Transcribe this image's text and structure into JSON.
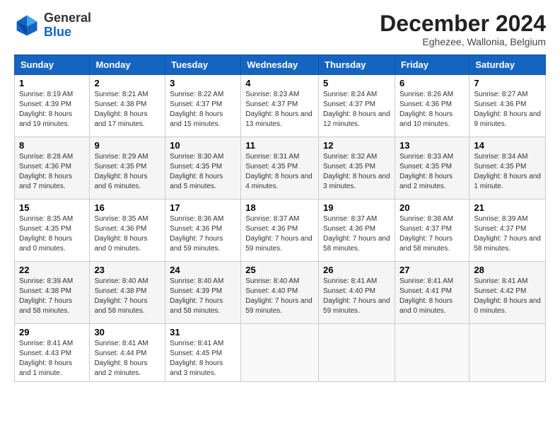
{
  "logo": {
    "line1": "General",
    "line2": "Blue"
  },
  "title": "December 2024",
  "subtitle": "Eghezee, Wallonia, Belgium",
  "days_header": [
    "Sunday",
    "Monday",
    "Tuesday",
    "Wednesday",
    "Thursday",
    "Friday",
    "Saturday"
  ],
  "weeks": [
    [
      {
        "day": "1",
        "sunrise": "8:19 AM",
        "sunset": "4:39 PM",
        "daylight": "8 hours and 19 minutes."
      },
      {
        "day": "2",
        "sunrise": "8:21 AM",
        "sunset": "4:38 PM",
        "daylight": "8 hours and 17 minutes."
      },
      {
        "day": "3",
        "sunrise": "8:22 AM",
        "sunset": "4:37 PM",
        "daylight": "8 hours and 15 minutes."
      },
      {
        "day": "4",
        "sunrise": "8:23 AM",
        "sunset": "4:37 PM",
        "daylight": "8 hours and 13 minutes."
      },
      {
        "day": "5",
        "sunrise": "8:24 AM",
        "sunset": "4:37 PM",
        "daylight": "8 hours and 12 minutes."
      },
      {
        "day": "6",
        "sunrise": "8:26 AM",
        "sunset": "4:36 PM",
        "daylight": "8 hours and 10 minutes."
      },
      {
        "day": "7",
        "sunrise": "8:27 AM",
        "sunset": "4:36 PM",
        "daylight": "8 hours and 9 minutes."
      }
    ],
    [
      {
        "day": "8",
        "sunrise": "8:28 AM",
        "sunset": "4:36 PM",
        "daylight": "8 hours and 7 minutes."
      },
      {
        "day": "9",
        "sunrise": "8:29 AM",
        "sunset": "4:35 PM",
        "daylight": "8 hours and 6 minutes."
      },
      {
        "day": "10",
        "sunrise": "8:30 AM",
        "sunset": "4:35 PM",
        "daylight": "8 hours and 5 minutes."
      },
      {
        "day": "11",
        "sunrise": "8:31 AM",
        "sunset": "4:35 PM",
        "daylight": "8 hours and 4 minutes."
      },
      {
        "day": "12",
        "sunrise": "8:32 AM",
        "sunset": "4:35 PM",
        "daylight": "8 hours and 3 minutes."
      },
      {
        "day": "13",
        "sunrise": "8:33 AM",
        "sunset": "4:35 PM",
        "daylight": "8 hours and 2 minutes."
      },
      {
        "day": "14",
        "sunrise": "8:34 AM",
        "sunset": "4:35 PM",
        "daylight": "8 hours and 1 minute."
      }
    ],
    [
      {
        "day": "15",
        "sunrise": "8:35 AM",
        "sunset": "4:35 PM",
        "daylight": "8 hours and 0 minutes."
      },
      {
        "day": "16",
        "sunrise": "8:35 AM",
        "sunset": "4:36 PM",
        "daylight": "8 hours and 0 minutes."
      },
      {
        "day": "17",
        "sunrise": "8:36 AM",
        "sunset": "4:36 PM",
        "daylight": "7 hours and 59 minutes."
      },
      {
        "day": "18",
        "sunrise": "8:37 AM",
        "sunset": "4:36 PM",
        "daylight": "7 hours and 59 minutes."
      },
      {
        "day": "19",
        "sunrise": "8:37 AM",
        "sunset": "4:36 PM",
        "daylight": "7 hours and 58 minutes."
      },
      {
        "day": "20",
        "sunrise": "8:38 AM",
        "sunset": "4:37 PM",
        "daylight": "7 hours and 58 minutes."
      },
      {
        "day": "21",
        "sunrise": "8:39 AM",
        "sunset": "4:37 PM",
        "daylight": "7 hours and 58 minutes."
      }
    ],
    [
      {
        "day": "22",
        "sunrise": "8:39 AM",
        "sunset": "4:38 PM",
        "daylight": "7 hours and 58 minutes."
      },
      {
        "day": "23",
        "sunrise": "8:40 AM",
        "sunset": "4:38 PM",
        "daylight": "7 hours and 58 minutes."
      },
      {
        "day": "24",
        "sunrise": "8:40 AM",
        "sunset": "4:39 PM",
        "daylight": "7 hours and 58 minutes."
      },
      {
        "day": "25",
        "sunrise": "8:40 AM",
        "sunset": "4:40 PM",
        "daylight": "7 hours and 59 minutes."
      },
      {
        "day": "26",
        "sunrise": "8:41 AM",
        "sunset": "4:40 PM",
        "daylight": "7 hours and 59 minutes."
      },
      {
        "day": "27",
        "sunrise": "8:41 AM",
        "sunset": "4:41 PM",
        "daylight": "8 hours and 0 minutes."
      },
      {
        "day": "28",
        "sunrise": "8:41 AM",
        "sunset": "4:42 PM",
        "daylight": "8 hours and 0 minutes."
      }
    ],
    [
      {
        "day": "29",
        "sunrise": "8:41 AM",
        "sunset": "4:43 PM",
        "daylight": "8 hours and 1 minute."
      },
      {
        "day": "30",
        "sunrise": "8:41 AM",
        "sunset": "4:44 PM",
        "daylight": "8 hours and 2 minutes."
      },
      {
        "day": "31",
        "sunrise": "8:41 AM",
        "sunset": "4:45 PM",
        "daylight": "8 hours and 3 minutes."
      },
      null,
      null,
      null,
      null
    ]
  ]
}
